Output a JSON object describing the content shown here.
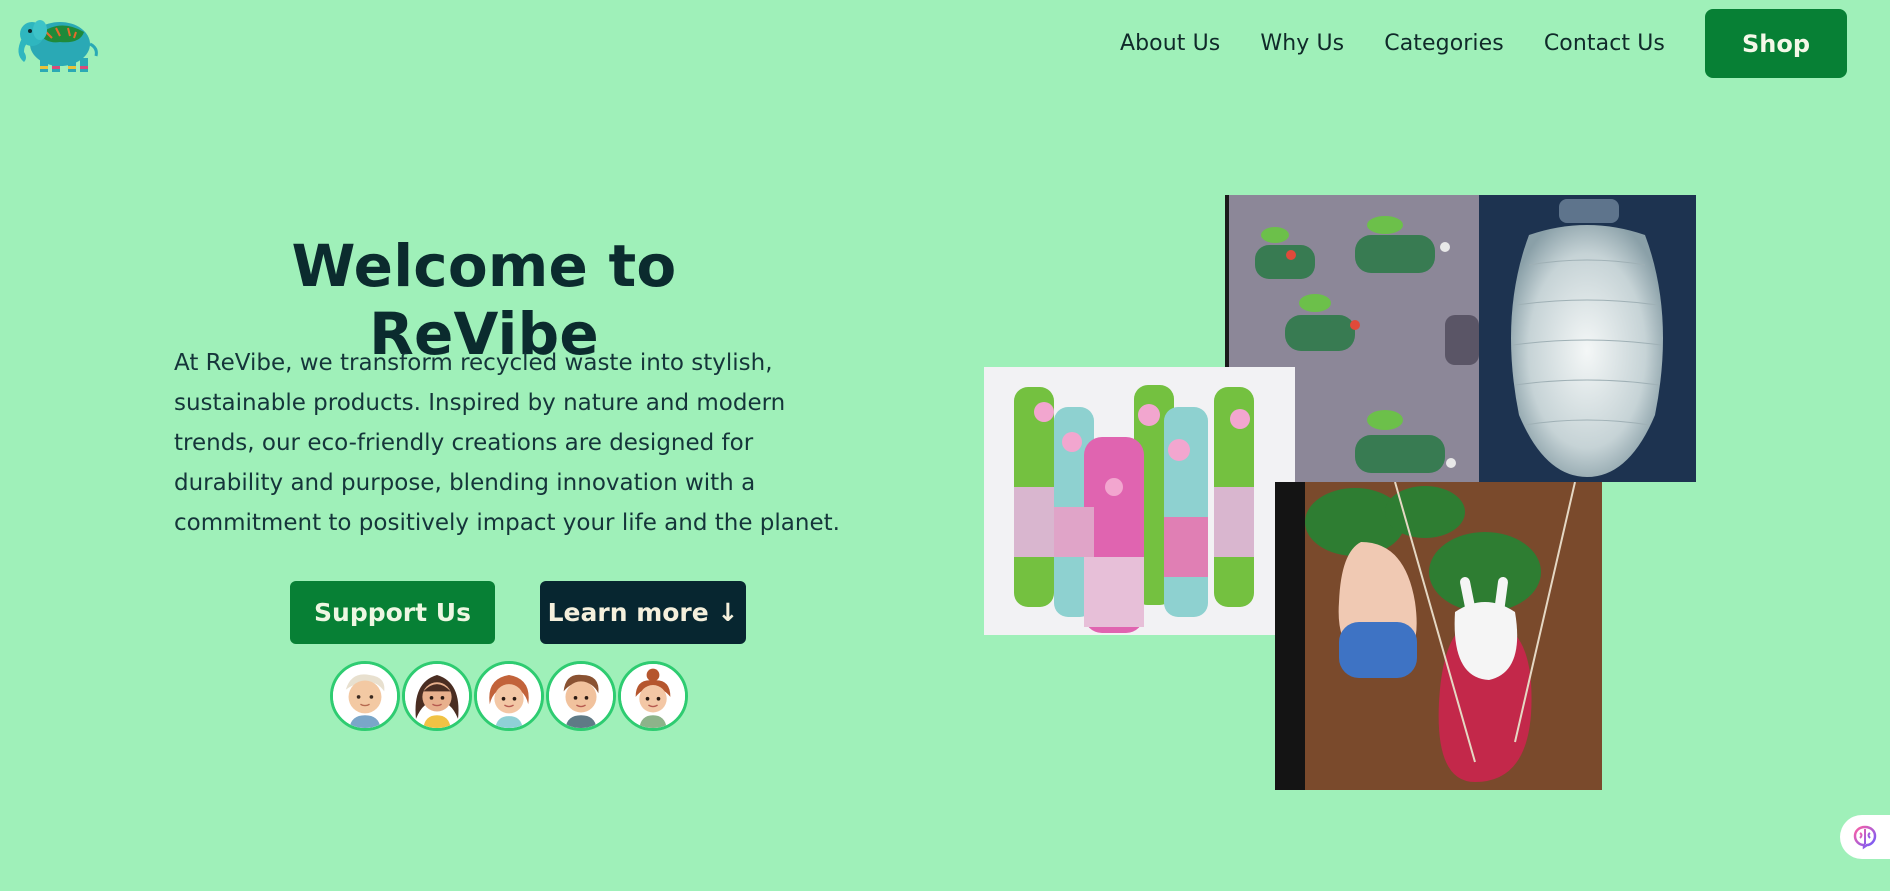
{
  "header": {
    "logo_icon": "elephant-logo-icon",
    "nav": [
      {
        "label": "About Us"
      },
      {
        "label": "Why Us"
      },
      {
        "label": "Categories"
      },
      {
        "label": "Contact Us"
      }
    ],
    "shop_label": "Shop"
  },
  "hero": {
    "title": "Welcome to ReVibe",
    "description": "At ReVibe, we transform recycled waste into stylish, sustainable products. Inspired by nature and modern trends, our eco-friendly creations are designed for durability and purpose, blending innovation with a commitment to positively impact your life and the planet.",
    "support_label": "Support Us",
    "learn_label": "Learn more ↓",
    "avatars": [
      "kid-avatar-1",
      "kid-avatar-2",
      "kid-avatar-3",
      "kid-avatar-4",
      "kid-avatar-5"
    ]
  },
  "collage": {
    "images": [
      "bottle-wall-planters-image",
      "spoon-lamp-image",
      "decorated-bottles-image",
      "hanging-animal-planters-image"
    ]
  },
  "widget": {
    "icon": "brain-icon"
  },
  "colors": {
    "background": "#9ff0b9",
    "primary_green": "#078035",
    "dark_navy": "#072630",
    "text_dark": "#0b2b2e"
  }
}
